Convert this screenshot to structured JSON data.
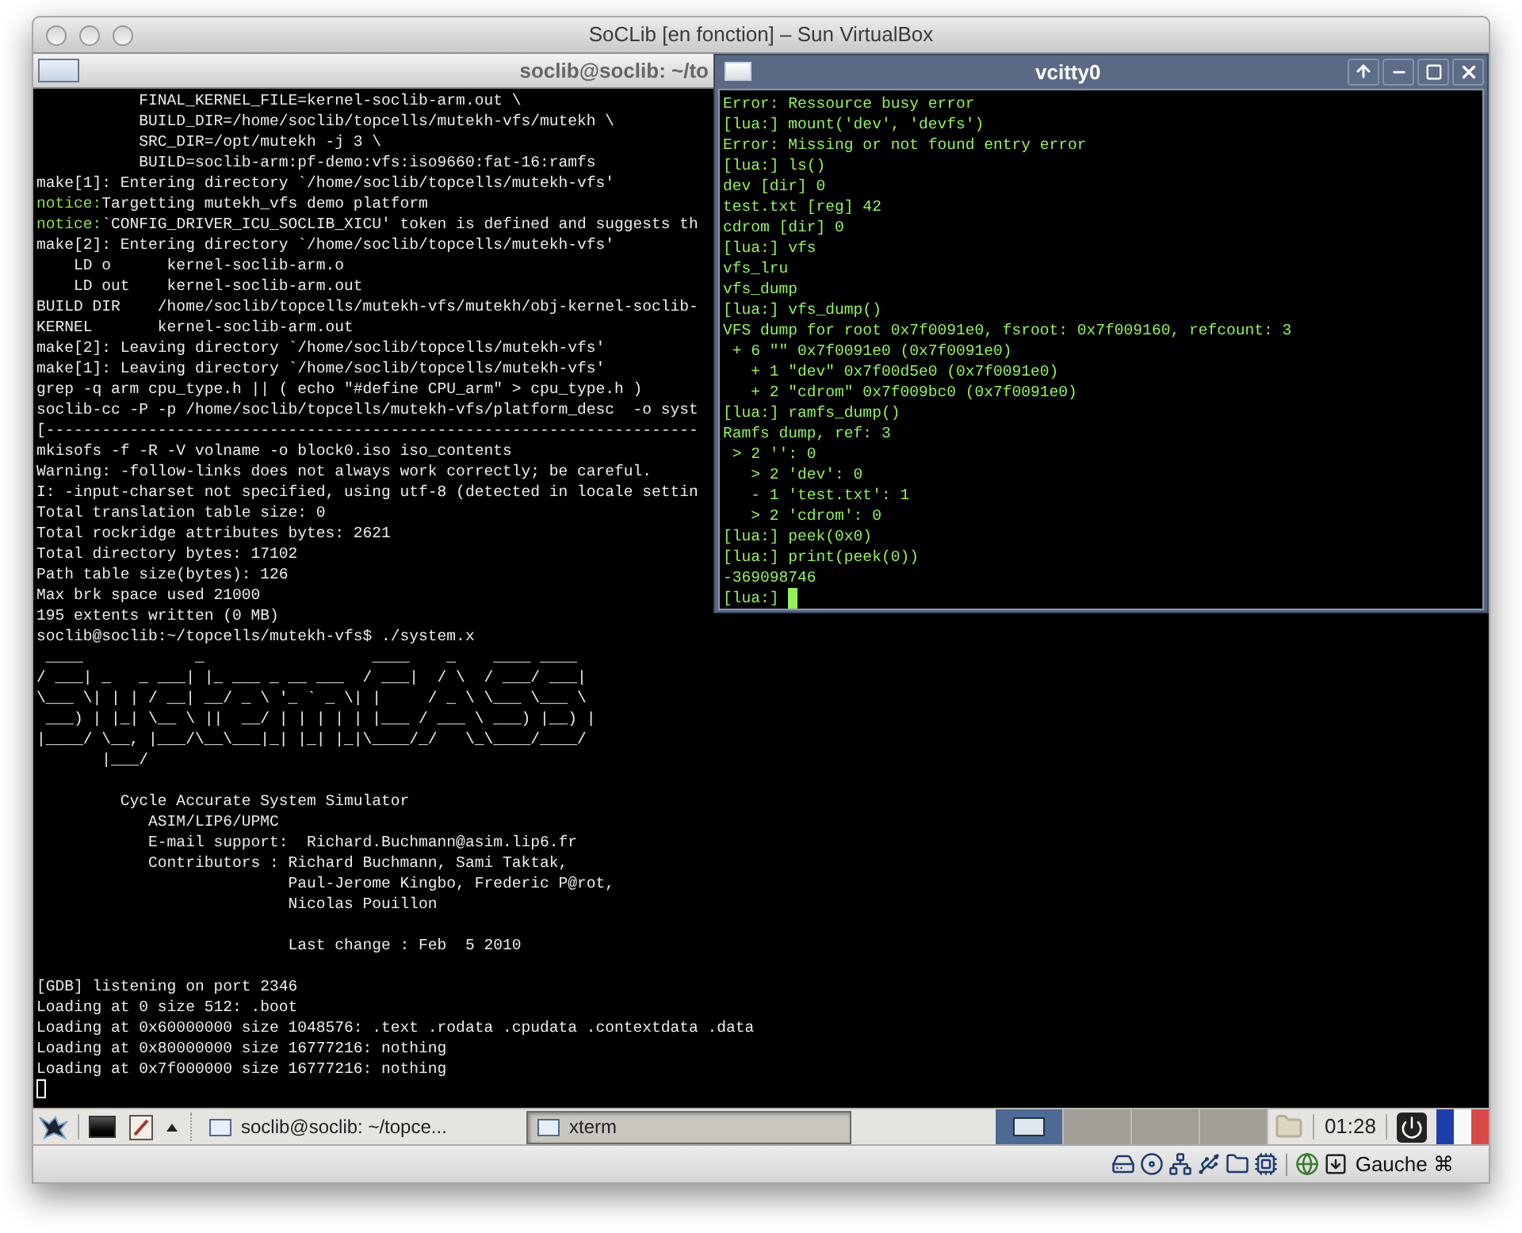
{
  "window": {
    "title": "SoCLib [en fonction] – Sun VirtualBox"
  },
  "xterm": {
    "title": "soclib@soclib: ~/to",
    "lines": [
      {
        "kind": "plain",
        "text": "           FINAL_KERNEL_FILE=kernel-soclib-arm.out \\"
      },
      {
        "kind": "plain",
        "text": "           BUILD_DIR=/home/soclib/topcells/mutekh-vfs/mutekh \\"
      },
      {
        "kind": "plain",
        "text": "           SRC_DIR=/opt/mutekh -j 3 \\"
      },
      {
        "kind": "plain",
        "text": "           BUILD=soclib-arm:pf-demo:vfs:iso9660:fat-16:ramfs"
      },
      {
        "kind": "plain",
        "text": "make[1]: Entering directory `/home/soclib/topcells/mutekh-vfs'"
      },
      {
        "kind": "notice",
        "label": "notice:",
        "text": "Targetting mutekh_vfs demo platform"
      },
      {
        "kind": "notice",
        "label": "notice:",
        "text": "`CONFIG_DRIVER_ICU_SOCLIB_XICU' token is defined and suggests th"
      },
      {
        "kind": "plain",
        "text": "make[2]: Entering directory `/home/soclib/topcells/mutekh-vfs'"
      },
      {
        "kind": "plain",
        "text": "    LD o      kernel-soclib-arm.o"
      },
      {
        "kind": "plain",
        "text": "    LD out    kernel-soclib-arm.out"
      },
      {
        "kind": "plain",
        "text": "BUILD DIR    /home/soclib/topcells/mutekh-vfs/mutekh/obj-kernel-soclib-"
      },
      {
        "kind": "plain",
        "text": "KERNEL       kernel-soclib-arm.out"
      },
      {
        "kind": "plain",
        "text": "make[2]: Leaving directory `/home/soclib/topcells/mutekh-vfs'"
      },
      {
        "kind": "plain",
        "text": "make[1]: Leaving directory `/home/soclib/topcells/mutekh-vfs'"
      },
      {
        "kind": "plain",
        "text": "grep -q arm cpu_type.h || ( echo \"#define CPU_arm\" > cpu_type.h )"
      },
      {
        "kind": "plain",
        "text": "soclib-cc -P -p /home/soclib/topcells/mutekh-vfs/platform_desc  -o syst"
      },
      {
        "kind": "plain",
        "text": "[----------------------------------------------------------------------"
      },
      {
        "kind": "plain",
        "text": "mkisofs -f -R -V volname -o block0.iso iso_contents"
      },
      {
        "kind": "plain",
        "text": "Warning: -follow-links does not always work correctly; be careful."
      },
      {
        "kind": "plain",
        "text": "I: -input-charset not specified, using utf-8 (detected in locale settin"
      },
      {
        "kind": "plain",
        "text": "Total translation table size: 0"
      },
      {
        "kind": "plain",
        "text": "Total rockridge attributes bytes: 2621"
      },
      {
        "kind": "plain",
        "text": "Total directory bytes: 17102"
      },
      {
        "kind": "plain",
        "text": "Path table size(bytes): 126"
      },
      {
        "kind": "plain",
        "text": "Max brk space used 21000"
      },
      {
        "kind": "plain",
        "text": "195 extents written (0 MB)"
      },
      {
        "kind": "plain",
        "text": "soclib@soclib:~/topcells/mutekh-vfs$ ./system.x"
      },
      {
        "kind": "plain",
        "text": " ____            _                  ____    _    ____ ____"
      },
      {
        "kind": "plain",
        "text": "/ ___| _   _ ___| |_ ___ _ __ ___  / ___|  / \\  / ___/ ___|"
      },
      {
        "kind": "plain",
        "text": "\\___ \\| | | / __| __/ _ \\ '_ ` _ \\| |     / _ \\ \\___ \\___ \\"
      },
      {
        "kind": "plain",
        "text": " ___) | |_| \\__ \\ ||  __/ | | | | | |___ / ___ \\ ___) |__) |"
      },
      {
        "kind": "plain",
        "text": "|____/ \\__, |___/\\__\\___|_| |_| |_|\\____/_/   \\_\\____/____/"
      },
      {
        "kind": "plain",
        "text": "       |___/"
      },
      {
        "kind": "blank"
      },
      {
        "kind": "plain",
        "text": "         Cycle Accurate System Simulator"
      },
      {
        "kind": "plain",
        "text": "            ASIM/LIP6/UPMC"
      },
      {
        "kind": "plain",
        "text": "            E-mail support:  Richard.Buchmann@asim.lip6.fr"
      },
      {
        "kind": "plain",
        "text": "            Contributors : Richard Buchmann, Sami Taktak,"
      },
      {
        "kind": "plain",
        "text": "                           Paul-Jerome Kingbo, Frederic P@rot,"
      },
      {
        "kind": "plain",
        "text": "                           Nicolas Pouillon"
      },
      {
        "kind": "blank"
      },
      {
        "kind": "plain",
        "text": "                           Last change : Feb  5 2010"
      },
      {
        "kind": "blank"
      },
      {
        "kind": "plain",
        "text": "[GDB] listening on port 2346"
      },
      {
        "kind": "plain",
        "text": "Loading at 0 size 512: .boot"
      },
      {
        "kind": "plain",
        "text": "Loading at 0x60000000 size 1048576: .text .rodata .cpudata .contextdata .data"
      },
      {
        "kind": "plain",
        "text": "Loading at 0x80000000 size 16777216: nothing"
      },
      {
        "kind": "plain",
        "text": "Loading at 0x7f000000 size 16777216: nothing"
      },
      {
        "kind": "cursor"
      }
    ]
  },
  "vcitty": {
    "title": "vcitty0",
    "lines": [
      {
        "kind": "plain",
        "text": "Error: Ressource busy error"
      },
      {
        "kind": "plain",
        "text": "[lua:] mount('dev', 'devfs')"
      },
      {
        "kind": "plain",
        "text": "Error: Missing or not found entry error"
      },
      {
        "kind": "plain",
        "text": "[lua:] ls()"
      },
      {
        "kind": "plain",
        "text": "dev [dir] 0"
      },
      {
        "kind": "plain",
        "text": "test.txt [reg] 42"
      },
      {
        "kind": "plain",
        "text": "cdrom [dir] 0"
      },
      {
        "kind": "plain",
        "text": "[lua:] vfs"
      },
      {
        "kind": "plain",
        "text": "vfs_lru"
      },
      {
        "kind": "plain",
        "text": "vfs_dump"
      },
      {
        "kind": "plain",
        "text": "[lua:] vfs_dump()"
      },
      {
        "kind": "plain",
        "text": "VFS dump for root 0x7f0091e0, fsroot: 0x7f009160, refcount: 3"
      },
      {
        "kind": "plain",
        "text": " + 6 \"\" 0x7f0091e0 (0x7f0091e0)"
      },
      {
        "kind": "plain",
        "text": "   + 1 \"dev\" 0x7f00d5e0 (0x7f0091e0)"
      },
      {
        "kind": "plain",
        "text": "   + 2 \"cdrom\" 0x7f009bc0 (0x7f0091e0)"
      },
      {
        "kind": "plain",
        "text": "[lua:] ramfs_dump()"
      },
      {
        "kind": "plain",
        "text": "Ramfs dump, ref: 3"
      },
      {
        "kind": "plain",
        "text": " > 2 '': 0"
      },
      {
        "kind": "plain",
        "text": "   > 2 'dev': 0"
      },
      {
        "kind": "plain",
        "text": "   - 1 'test.txt': 1"
      },
      {
        "kind": "plain",
        "text": "   > 2 'cdrom': 0"
      },
      {
        "kind": "plain",
        "text": "[lua:] peek(0x0)"
      },
      {
        "kind": "plain",
        "text": "[lua:] print(peek(0))"
      },
      {
        "kind": "plain",
        "text": "-369098746"
      },
      {
        "kind": "prompt_cursor",
        "text": "[lua:]"
      }
    ]
  },
  "taskbar": {
    "tasks": [
      {
        "label": "soclib@soclib: ~/topce...",
        "selected": false
      },
      {
        "label": "xterm",
        "selected": true
      }
    ],
    "desktops": [
      {
        "selected": true
      },
      {
        "selected": false
      },
      {
        "selected": false
      },
      {
        "selected": false
      }
    ],
    "clock": "01:28"
  },
  "status_bar": {
    "host_key": "Gauche ⌘"
  }
}
